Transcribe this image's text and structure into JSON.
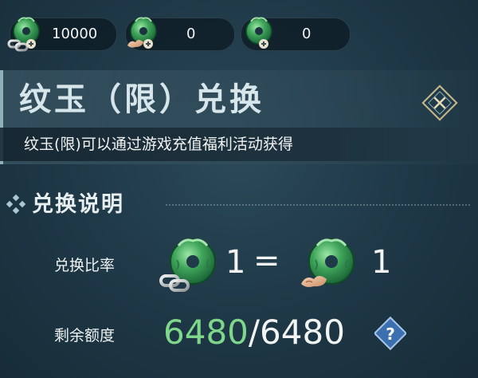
{
  "currency_bar": [
    {
      "icon": "jade-coin-chain-icon",
      "value": "10000"
    },
    {
      "icon": "jade-coin-cloud-icon",
      "value": "0"
    },
    {
      "icon": "jade-coin-icon",
      "value": "0"
    }
  ],
  "banner": {
    "title": "纹玉（限）兑换",
    "subtitle": "纹玉(限)可以通过游戏充值福利活动获得"
  },
  "section": {
    "title": "兑换说明"
  },
  "exchange_rate": {
    "label": "兑换比率",
    "left_amount": "1",
    "equals": "=",
    "right_amount": "1"
  },
  "quota": {
    "label": "剩余额度",
    "current": "6480",
    "separator": "/",
    "total": "6480"
  },
  "colors": {
    "jade_green": "#3fa45a",
    "remaining_green": "#7ed78a",
    "help_blue": "#3b6fb0"
  }
}
